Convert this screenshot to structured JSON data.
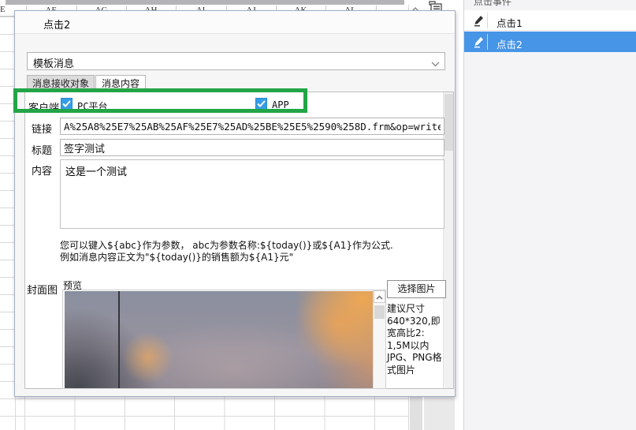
{
  "sheet": {
    "corner_header": "E",
    "columns": [
      "AF",
      "AG",
      "AH",
      "AI",
      "AJ",
      "AK",
      "AL"
    ]
  },
  "dialog": {
    "title": "点击2",
    "message_type": "模板消息",
    "tabs": [
      {
        "label": "消息接收对象"
      },
      {
        "label": "消息内容"
      }
    ],
    "client": {
      "label": "客户端",
      "options": [
        {
          "label": "PC平台",
          "checked": true
        },
        {
          "label": "APP",
          "checked": true
        }
      ]
    },
    "link": {
      "label": "链接",
      "value": "A%25A8%25E7%25AB%25AF%25E7%25AD%25BE%25E5%2590%258D.frm&op=write"
    },
    "title_field": {
      "label": "标题",
      "value": "签字测试"
    },
    "content_field": {
      "label": "内容",
      "value": "这是一个测试"
    },
    "hints": [
      "您可以键入${abc}作为参数， abc为参数名称:${today()}或${A1}作为公式.",
      "例如消息内容正文为\"${today()}的销售额为${A1}元\""
    ],
    "cover": {
      "label": "封面图",
      "preview_label": "预览",
      "choose_button": "选择图片",
      "suggestion_lines": [
        "建议尺寸",
        "640*320,即",
        "宽高比2:",
        "1,5M以内",
        "JPG、PNG格",
        "式图片"
      ]
    }
  },
  "sidebar": {
    "title": "点击事件",
    "items": [
      {
        "label": "点击1",
        "selected": false
      },
      {
        "label": "点击2",
        "selected": true
      }
    ]
  },
  "colors": {
    "annotation_green": "#22a546",
    "selection_blue": "#4795e7",
    "checkbox_blue": "#359ce8"
  }
}
